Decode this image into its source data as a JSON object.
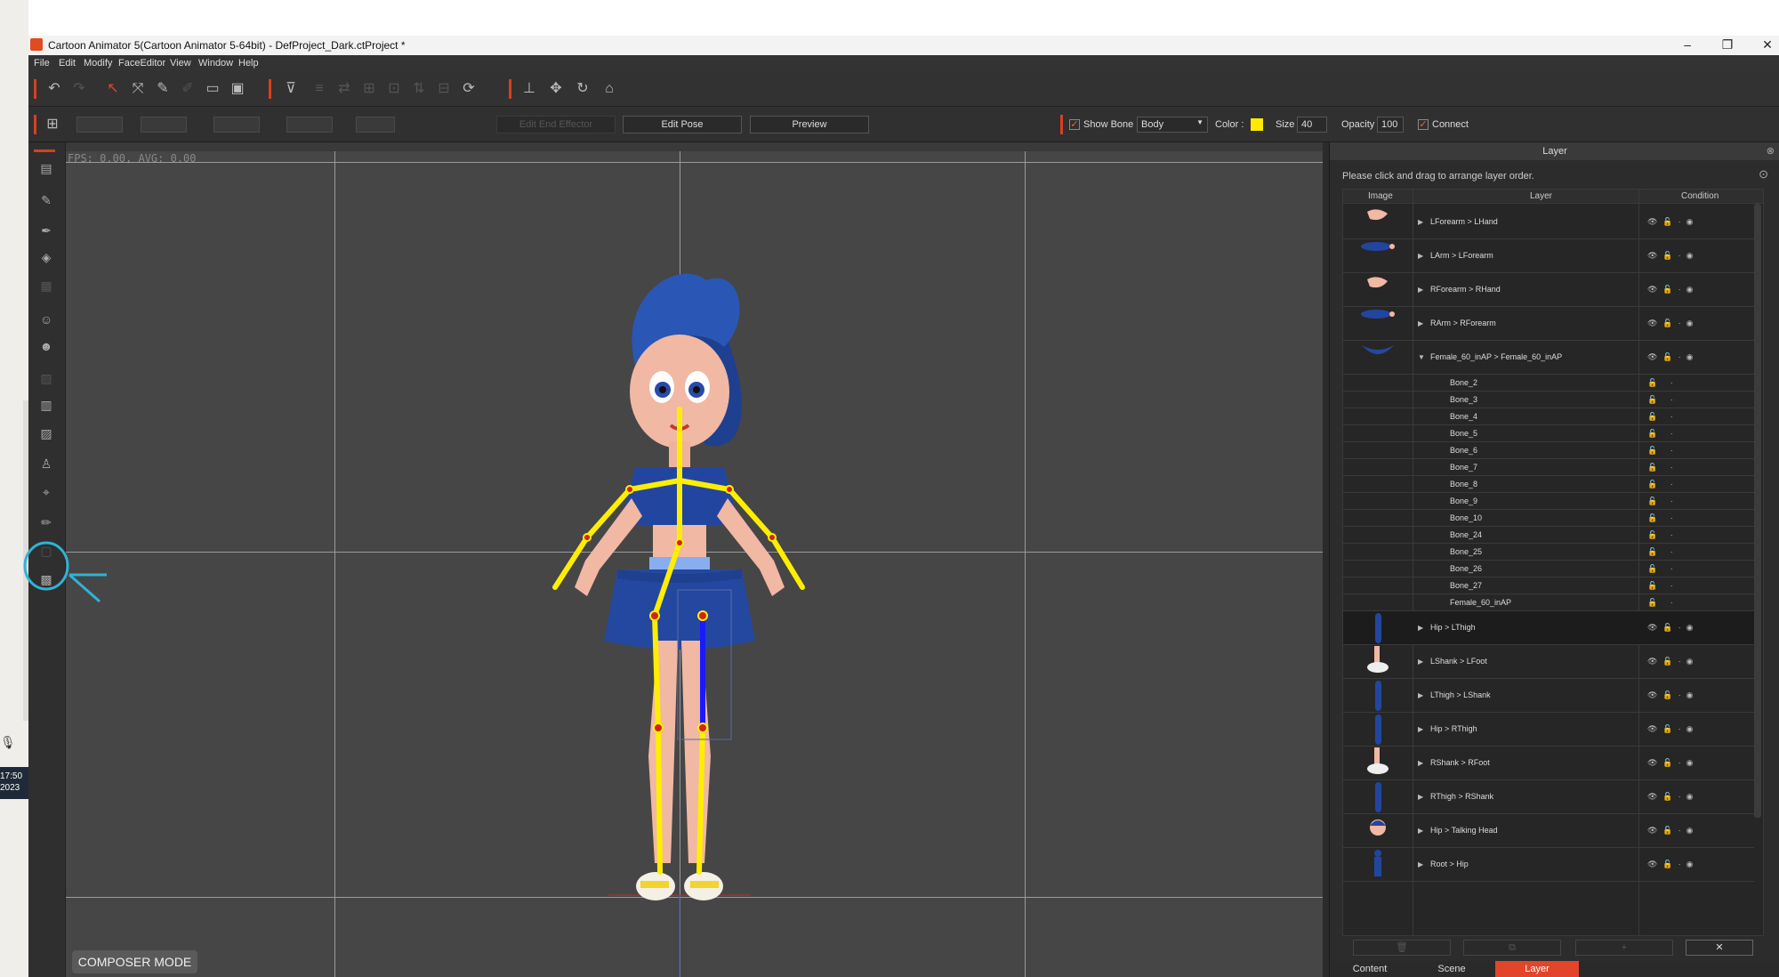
{
  "window": {
    "title": "Cartoon Animator 5(Cartoon Animator 5-64bit) - DefProject_Dark.ctProject *",
    "controls": [
      "–",
      "❐",
      "✕"
    ]
  },
  "taskbar": {
    "time": "17:50",
    "year": "2023"
  },
  "menu": [
    "File",
    "Edit",
    "Modify",
    "FaceEditor",
    "View",
    "Window",
    "Help"
  ],
  "toolbar2": {
    "edit_end_effector": "Edit End Effector",
    "edit_pose": "Edit Pose",
    "preview": "Preview",
    "show_bone": "Show Bone",
    "body_select": "Body",
    "color_label": "Color :",
    "size_label": "Size :",
    "size_value": "40",
    "opacity_label": "Opacity :",
    "opacity_value": "100",
    "connect": "Connect",
    "color_swatch": "#ffea00"
  },
  "viewport": {
    "fps": "FPS: 0.00, AVG: 0.00",
    "composer_mode": "COMPOSER MODE"
  },
  "layer_panel": {
    "title": "Layer",
    "hint": "Please click and drag to arrange layer order.",
    "columns": [
      "Image",
      "Layer",
      "Condition"
    ],
    "rows": [
      {
        "name": "LForearm > LHand",
        "kind": "group",
        "thumb": "hand"
      },
      {
        "name": "LArm > LForearm",
        "kind": "group",
        "thumb": "arm"
      },
      {
        "name": "RForearm > RHand",
        "kind": "group",
        "thumb": "hand"
      },
      {
        "name": "RArm > RForearm",
        "kind": "group",
        "thumb": "arm"
      },
      {
        "name": "Female_60_inAP > Female_60_inAP",
        "kind": "group-open",
        "thumb": "skirt"
      },
      {
        "name": "Bone_2",
        "kind": "bone"
      },
      {
        "name": "Bone_3",
        "kind": "bone"
      },
      {
        "name": "Bone_4",
        "kind": "bone"
      },
      {
        "name": "Bone_5",
        "kind": "bone"
      },
      {
        "name": "Bone_6",
        "kind": "bone"
      },
      {
        "name": "Bone_7",
        "kind": "bone"
      },
      {
        "name": "Bone_8",
        "kind": "bone"
      },
      {
        "name": "Bone_9",
        "kind": "bone"
      },
      {
        "name": "Bone_10",
        "kind": "bone"
      },
      {
        "name": "Bone_24",
        "kind": "bone"
      },
      {
        "name": "Bone_25",
        "kind": "bone"
      },
      {
        "name": "Bone_26",
        "kind": "bone"
      },
      {
        "name": "Bone_27",
        "kind": "bone"
      },
      {
        "name": "Female_60_inAP",
        "kind": "bone"
      },
      {
        "name": "Hip > LThigh",
        "kind": "group",
        "thumb": "leg",
        "selected": true
      },
      {
        "name": "LShank > LFoot",
        "kind": "group",
        "thumb": "shoe"
      },
      {
        "name": "LThigh > LShank",
        "kind": "group",
        "thumb": "leg"
      },
      {
        "name": "Hip > RThigh",
        "kind": "group",
        "thumb": "leg"
      },
      {
        "name": "RShank > RFoot",
        "kind": "group",
        "thumb": "shoe"
      },
      {
        "name": "RThigh > RShank",
        "kind": "group",
        "thumb": "leg"
      },
      {
        "name": "Hip > Talking Head",
        "kind": "group",
        "thumb": "head"
      },
      {
        "name": "Root > Hip",
        "kind": "group",
        "thumb": "body"
      }
    ],
    "close_button": "✕",
    "tabs": [
      "Content",
      "Scene",
      "Layer"
    ],
    "active_tab": "Layer"
  }
}
